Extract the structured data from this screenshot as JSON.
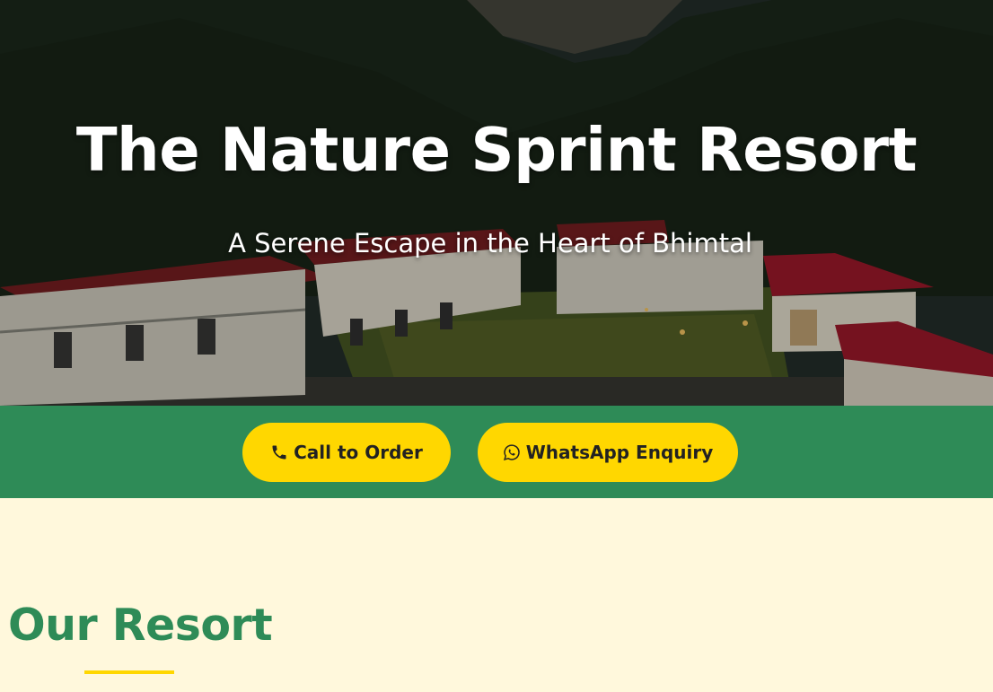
{
  "hero": {
    "title": "The Nature Sprint Resort",
    "subtitle": "A Serene Escape in the Heart of Bhimtal"
  },
  "cta": {
    "call_label": "Call to Order",
    "call_icon": "phone-icon",
    "whatsapp_label": "WhatsApp Enquiry",
    "whatsapp_icon": "whatsapp-icon"
  },
  "section": {
    "title": "Our Resort"
  },
  "colors": {
    "primary_green": "#2e8b57",
    "accent_yellow": "#ffd700",
    "cream_background": "#fff8dc"
  }
}
